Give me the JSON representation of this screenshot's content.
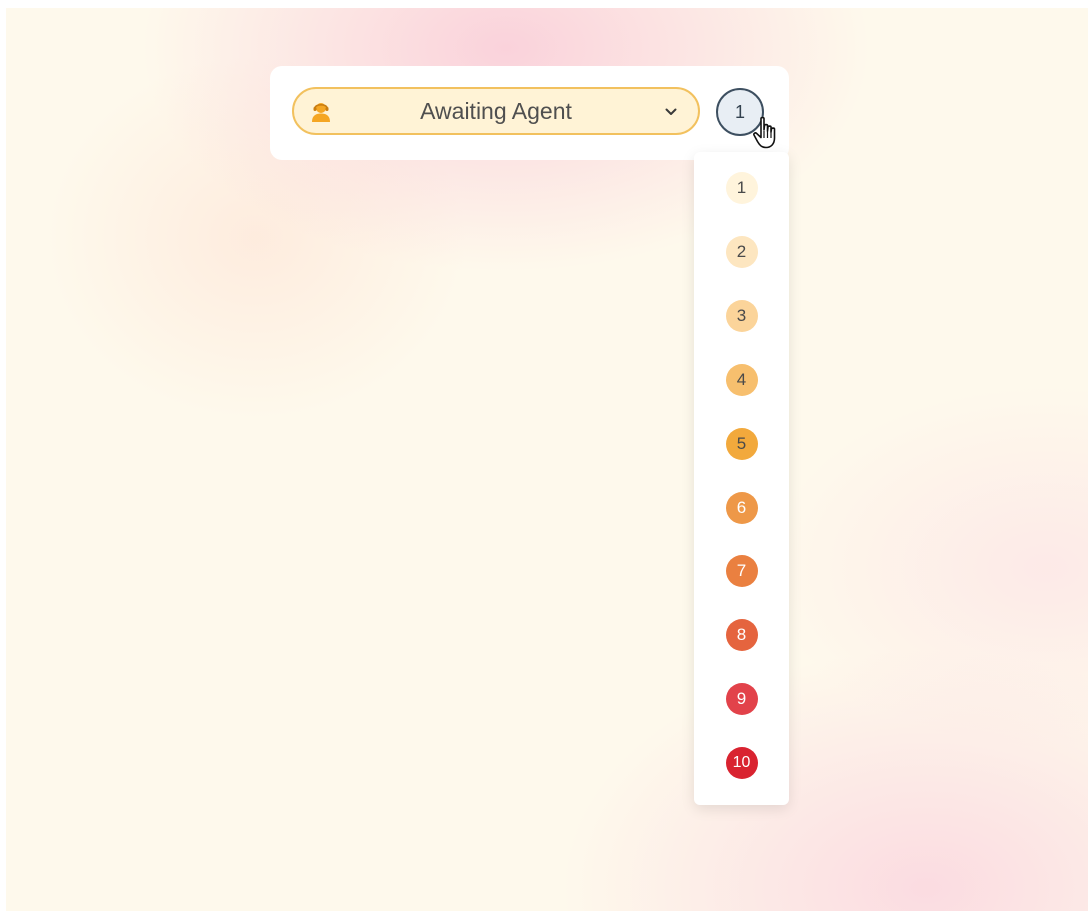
{
  "status_dropdown": {
    "selected_label": "Awaiting Agent",
    "icon": "agent-icon",
    "chevron_icon": "chevron-down-icon",
    "border_color": "#f2c15e",
    "background_color": "#fff3d6"
  },
  "priority": {
    "selected": "1",
    "options": [
      {
        "label": "1",
        "color": "#fff4dc",
        "text_color": "#4a4a4a"
      },
      {
        "label": "2",
        "color": "#fde6c0",
        "text_color": "#4a4a4a"
      },
      {
        "label": "3",
        "color": "#fbd49a",
        "text_color": "#4a4a4a"
      },
      {
        "label": "4",
        "color": "#f7bf6e",
        "text_color": "#4a4a4a"
      },
      {
        "label": "5",
        "color": "#f2a93c",
        "text_color": "#4a4a4a"
      },
      {
        "label": "6",
        "color": "#ee9848",
        "text_color": "#ffffff"
      },
      {
        "label": "7",
        "color": "#ea8040",
        "text_color": "#ffffff"
      },
      {
        "label": "8",
        "color": "#e5643e",
        "text_color": "#ffffff"
      },
      {
        "label": "9",
        "color": "#e2424a",
        "text_color": "#ffffff"
      },
      {
        "label": "10",
        "color": "#d92330",
        "text_color": "#ffffff"
      }
    ]
  }
}
